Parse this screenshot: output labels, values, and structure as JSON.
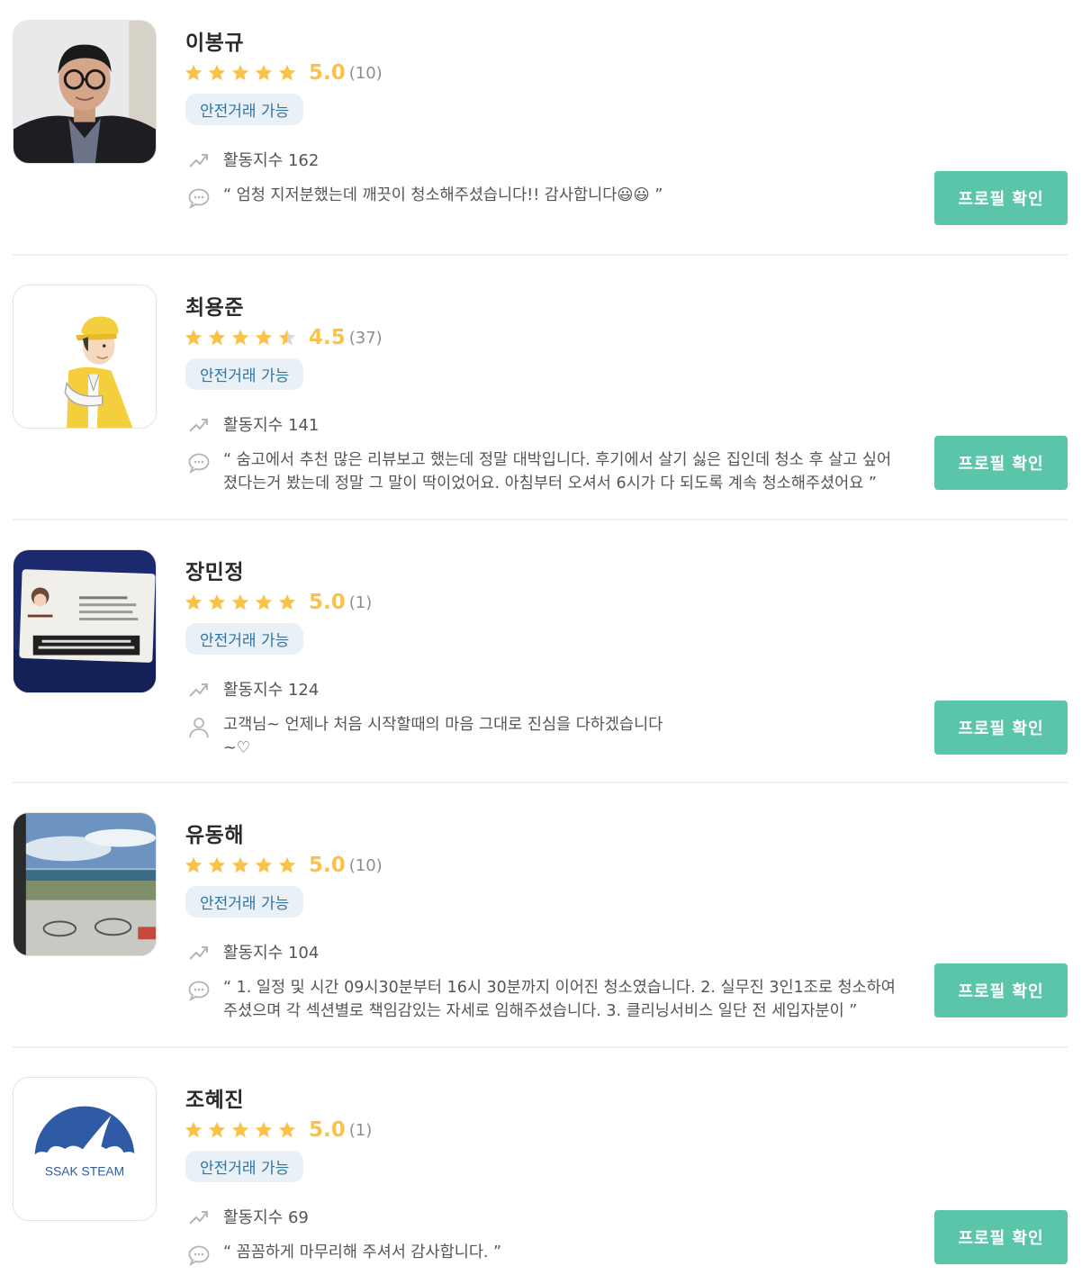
{
  "colors": {
    "accent": "#5ac5a9",
    "star": "#f9c34b",
    "star_empty": "#d8d8d8",
    "badge_bg": "#e9f1f6",
    "badge_text": "#2f74a6"
  },
  "providers": [
    {
      "name": "이봉규",
      "rating": "5.0",
      "stars": 5,
      "review_count": "(10)",
      "badge": "안전거래 가능",
      "activity": "활동지수 162",
      "review_icon": "speech-bubble-icon",
      "review": "“ 엄청 지저분했는데 깨끗이 청소해주셨습니다!! 감사합니다😃😃 ”",
      "button": "프로필 확인",
      "avatar": "man-with-glasses-photo"
    },
    {
      "name": "최용준",
      "rating": "4.5",
      "stars": 4.5,
      "review_count": "(37)",
      "badge": "안전거래 가능",
      "activity": "활동지수 141",
      "review_icon": "speech-bubble-icon",
      "review": "“ 숨고에서 추천 많은 리뷰보고 했는데 정말 대박입니다. 후기에서 살기 싫은 집인데 청소 후 살고 싶어졌다는거 봤는데 정말 그 말이 딱이었어요. 아침부터 오셔서 6시가 다 되도록 계속 청소해주셨어요 ”",
      "button": "프로필 확인",
      "avatar": "cartoon-worker-illustration"
    },
    {
      "name": "장민정",
      "rating": "5.0",
      "stars": 5,
      "review_count": "(1)",
      "badge": "안전거래 가능",
      "activity": "활동지수 124",
      "review_icon": "person-icon",
      "review": "고객님~ 언제나 처음 시작할때의 마음 그대로 진심을 다하겠습니다 ~♡",
      "button": "프로필 확인",
      "avatar": "business-card-photo"
    },
    {
      "name": "유동해",
      "rating": "5.0",
      "stars": 5,
      "review_count": "(10)",
      "badge": "안전거래 가능",
      "activity": "활동지수 104",
      "review_icon": "speech-bubble-icon",
      "review": "“ 1. 일정 및 시간 09시30분부터 16시 30분까지 이어진 청소였습니다. 2. 실무진 3인1조로 청소하여주셨으며 각 섹션별로 책임감있는 자세로 임해주셨습니다. 3. 클리닝서비스 일단 전 세입자분이 ”",
      "button": "프로필 확인",
      "avatar": "sea-view-balcony-photo"
    },
    {
      "name": "조혜진",
      "rating": "5.0",
      "stars": 5,
      "review_count": "(1)",
      "badge": "안전거래 가능",
      "activity": "활동지수 69",
      "review_icon": "speech-bubble-icon",
      "review": "“ 꼼꼼하게 마무리해 주셔서 감사합니다. ”",
      "button": "프로필 확인",
      "avatar": "ssak-steam-logo",
      "logo_text": "SSAK STEAM"
    }
  ]
}
